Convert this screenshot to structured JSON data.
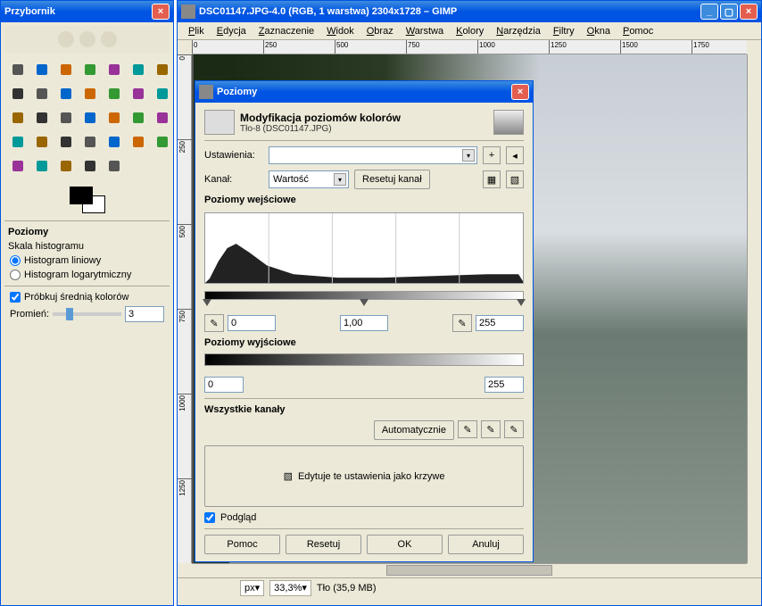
{
  "toolbox": {
    "title": "Przybornik",
    "tools": [
      "rect-select-icon",
      "ellipse-select-icon",
      "free-select-icon",
      "fuzzy-select-icon",
      "color-select-icon",
      "scissors-icon",
      "foreground-select-icon",
      "paths-icon",
      "color-picker-icon",
      "zoom-icon",
      "measure-icon",
      "move-icon",
      "align-icon",
      "crop-icon",
      "rotate-icon",
      "scale-icon",
      "shear-icon",
      "perspective-icon",
      "flip-icon",
      "text-icon",
      "bucket-fill-icon",
      "blend-icon",
      "pencil-icon",
      "paintbrush-icon",
      "eraser-icon",
      "airbrush-icon",
      "ink-icon",
      "clone-icon",
      "heal-icon",
      "perspective-clone-icon",
      "blur-icon",
      "smudge-icon",
      "dodge-icon"
    ],
    "panel_title": "Poziomy",
    "scale_label": "Skala histogramu",
    "radio_linear": "Histogram liniowy",
    "radio_log": "Histogram logarytmiczny",
    "sample_avg": "Próbkuj średnią kolorów",
    "radius_label": "Promień:",
    "radius_value": "3"
  },
  "main": {
    "title": "DSC01147.JPG-4.0 (RGB, 1 warstwa) 2304x1728 – GIMP",
    "menu": [
      "Plik",
      "Edycja",
      "Zaznaczenie",
      "Widok",
      "Obraz",
      "Warstwa",
      "Kolory",
      "Narzędzia",
      "Filtry",
      "Okna",
      "Pomoc"
    ],
    "ruler_h": [
      "0",
      "250",
      "500",
      "750",
      "1000",
      "1250",
      "1500",
      "1750"
    ],
    "ruler_v": [
      "0",
      "250",
      "500",
      "750",
      "1000",
      "1250"
    ],
    "status_unit": "px",
    "status_zoom": "33,3%",
    "status_layer": "Tło (35,9 MB)"
  },
  "levels": {
    "title": "Poziomy",
    "head_title": "Modyfikacja poziomów kolorów",
    "head_sub": "Tło-8 (DSC01147.JPG)",
    "settings_label": "Ustawienia:",
    "channel_label": "Kanał:",
    "channel_value": "Wartość",
    "reset_channel": "Resetuj kanał",
    "input_levels": "Poziomy wejściowe",
    "in_low": "0",
    "in_gamma": "1,00",
    "in_high": "255",
    "output_levels": "Poziomy wyjściowe",
    "out_low": "0",
    "out_high": "255",
    "all_channels": "Wszystkie kanały",
    "auto": "Automatycznie",
    "edit_curves": "Edytuje te ustawienia jako krzywe",
    "preview": "Podgląd",
    "help": "Pomoc",
    "reset": "Resetuj",
    "ok": "OK",
    "cancel": "Anuluj"
  }
}
